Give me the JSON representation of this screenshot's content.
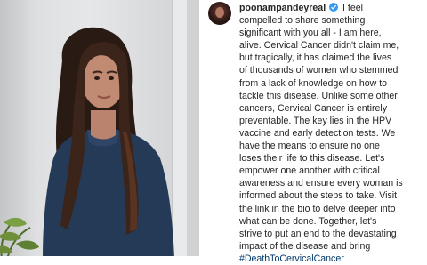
{
  "post": {
    "username": "poonampandeyreal",
    "verified": true,
    "caption_lines": [
      "I feel",
      "compelled to share something",
      "significant with you all - I am here,",
      "alive. Cervical Cancer didn't claim me,",
      "but tragically, it has claimed the lives",
      "of thousands of women who stemmed",
      "from a lack of knowledge on how to",
      "tackle this disease. Unlike some other",
      "cancers, Cervical Cancer is entirely",
      "preventable. The key lies in the HPV",
      "vaccine and early detection tests. We",
      "have the means to ensure no one",
      "loses their life to this disease. Let's",
      "empower one another with critical",
      "awareness and ensure every woman is",
      "informed about the steps to take. Visit",
      "the link in the bio to delve deeper into",
      "what can be done. Together, let's",
      "strive to put an end to the devastating",
      "impact of the disease and bring"
    ],
    "hashtag": "#DeathToCervicalCancer"
  },
  "colors": {
    "text": "#262626",
    "hashtag": "#00376b",
    "verified_badge": "#3897f0"
  }
}
